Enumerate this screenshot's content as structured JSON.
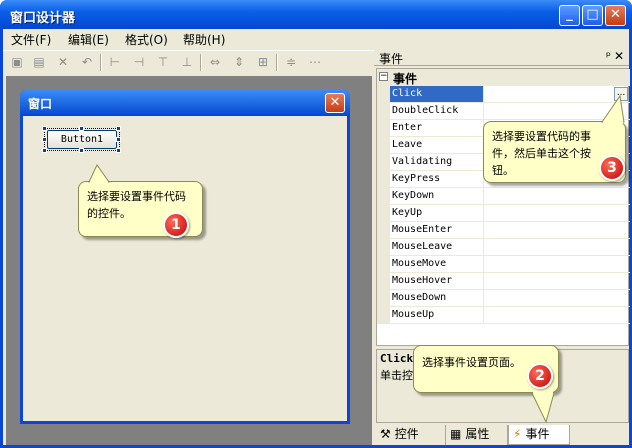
{
  "window": {
    "title": "窗口设计器",
    "min": "_",
    "max": "□",
    "close": "✕"
  },
  "menu": [
    "文件(F)",
    "编辑(E)",
    "格式(O)",
    "帮助(H)"
  ],
  "form": {
    "title": "窗口",
    "button_label": "Button1"
  },
  "panel": {
    "title": "事件",
    "pin": "ᵖ",
    "close": "✕",
    "category": "事件",
    "events": [
      "Click",
      "DoubleClick",
      "Enter",
      "Leave",
      "Validating",
      "KeyPress",
      "KeyDown",
      "KeyUp",
      "MouseEnter",
      "MouseLeave",
      "MouseMove",
      "MouseHover",
      "MouseDown",
      "MouseUp"
    ],
    "selected": "Click",
    "ellipsis": "...",
    "desc_title": "Click",
    "desc_text": "单击控",
    "tabs": [
      {
        "label": "控件",
        "icon": "tools-icon"
      },
      {
        "label": "属性",
        "icon": "properties-icon"
      },
      {
        "label": "事件",
        "icon": "lightning-icon"
      }
    ]
  },
  "callouts": {
    "c1": {
      "text_line1": "选择要设置事件代码",
      "text_line2": "的控件。",
      "num": "1"
    },
    "c2": {
      "text": "选择事件设置页面。",
      "num": "2"
    },
    "c3": {
      "text_line1": "选择要设置代码的事",
      "text_line2": "件，然后单击这个按",
      "text_line3": "钮。",
      "num": "3"
    }
  },
  "colors": {
    "xp_blue": "#0a47d6",
    "callout_bg": "#ffffc8",
    "badge_red": "#c40000",
    "selection": "#316ac5"
  }
}
